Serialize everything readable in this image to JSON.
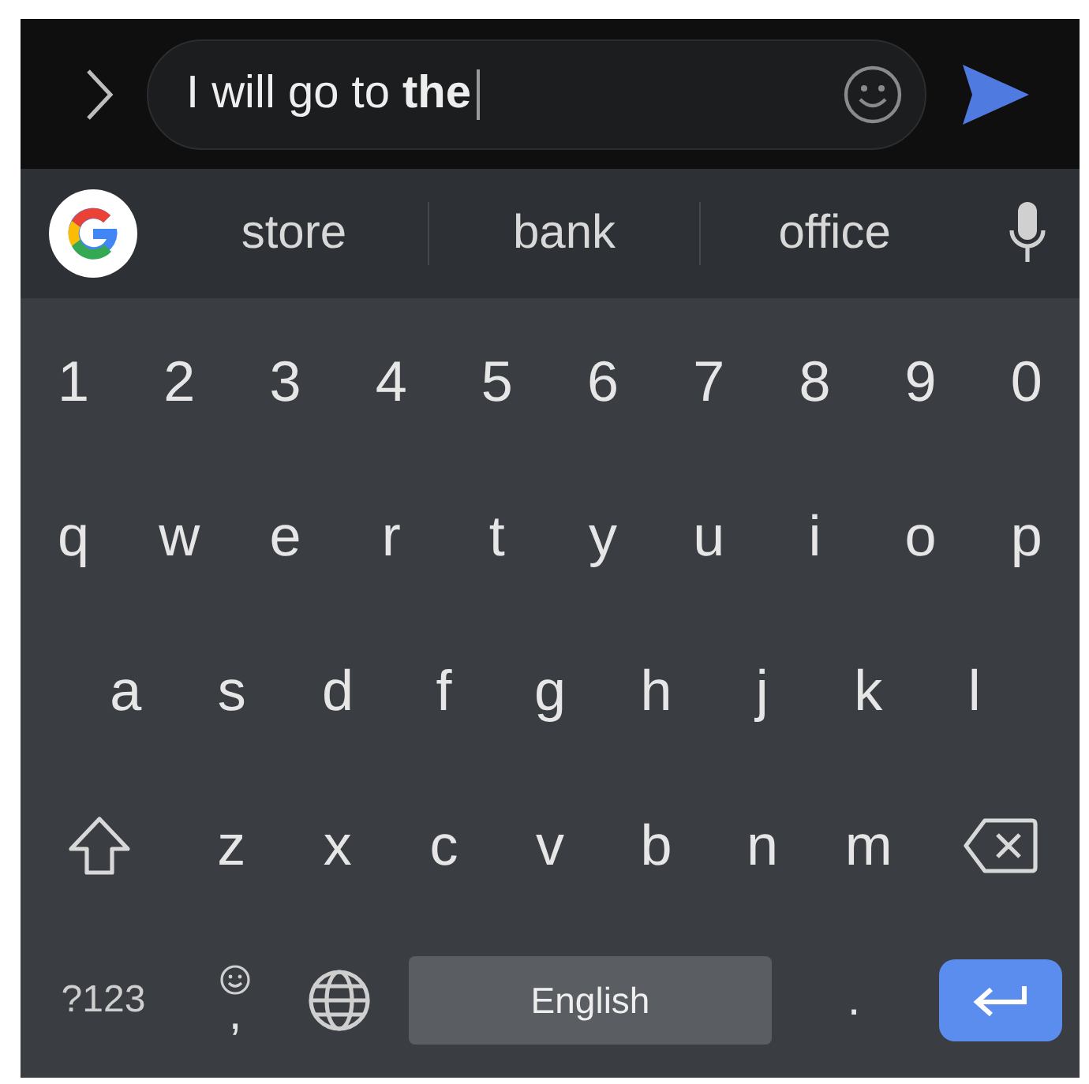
{
  "compose": {
    "text": "I will go to **the**"
  },
  "suggestions": [
    "store",
    "bank",
    "office"
  ],
  "rows": [
    [
      {
        "kind": "char",
        "label": "1"
      },
      {
        "kind": "char",
        "label": "2"
      },
      {
        "kind": "char",
        "label": "3"
      },
      {
        "kind": "char",
        "label": "4"
      },
      {
        "kind": "char",
        "label": "5"
      },
      {
        "kind": "char",
        "label": "6"
      },
      {
        "kind": "char",
        "label": "7"
      },
      {
        "kind": "char",
        "label": "8"
      },
      {
        "kind": "char",
        "label": "9"
      },
      {
        "kind": "char",
        "label": "0"
      }
    ],
    [
      {
        "kind": "char",
        "label": "q"
      },
      {
        "kind": "char",
        "label": "w"
      },
      {
        "kind": "char",
        "label": "e"
      },
      {
        "kind": "char",
        "label": "r"
      },
      {
        "kind": "char",
        "label": "t"
      },
      {
        "kind": "char",
        "label": "y"
      },
      {
        "kind": "char",
        "label": "u"
      },
      {
        "kind": "char",
        "label": "i"
      },
      {
        "kind": "char",
        "label": "o"
      },
      {
        "kind": "char",
        "label": "p"
      }
    ],
    [
      {
        "kind": "char",
        "label": "a"
      },
      {
        "kind": "char",
        "label": "s"
      },
      {
        "kind": "char",
        "label": "d"
      },
      {
        "kind": "char",
        "label": "f"
      },
      {
        "kind": "char",
        "label": "g"
      },
      {
        "kind": "char",
        "label": "h"
      },
      {
        "kind": "char",
        "label": "j"
      },
      {
        "kind": "char",
        "label": "k"
      },
      {
        "kind": "char",
        "label": "l"
      }
    ],
    [
      {
        "kind": "shift"
      },
      {
        "kind": "char",
        "label": "z"
      },
      {
        "kind": "char",
        "label": "x"
      },
      {
        "kind": "char",
        "label": "c"
      },
      {
        "kind": "char",
        "label": "v"
      },
      {
        "kind": "char",
        "label": "b"
      },
      {
        "kind": "char",
        "label": "n"
      },
      {
        "kind": "char",
        "label": "m"
      },
      {
        "kind": "backspace"
      }
    ],
    [
      {
        "kind": "symbols",
        "label": "?123"
      },
      {
        "kind": "comma",
        "label": ","
      },
      {
        "kind": "globe"
      },
      {
        "kind": "space",
        "label": "English"
      },
      {
        "kind": "period",
        "label": "."
      },
      {
        "kind": "enter"
      }
    ]
  ]
}
